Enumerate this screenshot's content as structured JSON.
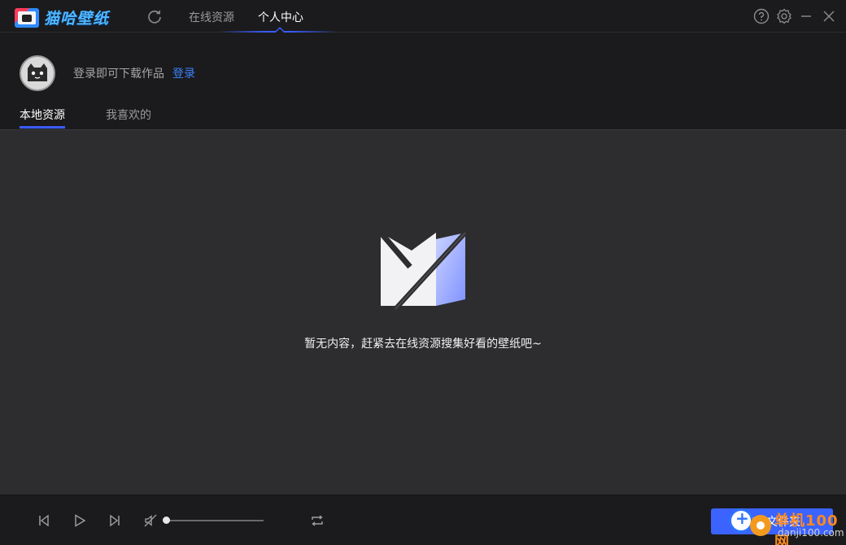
{
  "app": {
    "title": "猫哈壁纸"
  },
  "nav": {
    "tabs": [
      {
        "label": "在线资源",
        "active": false
      },
      {
        "label": "个人中心",
        "active": true
      }
    ]
  },
  "window_controls": [
    "help-icon",
    "settings-icon",
    "minimize-icon",
    "close-icon"
  ],
  "profile": {
    "login_hint": "登录即可下载作品",
    "login_link": "登录"
  },
  "sub_tabs": [
    {
      "label": "本地资源",
      "active": true
    },
    {
      "label": "我喜欢的",
      "active": false
    }
  ],
  "empty_state": {
    "message": "暂无内容，赶紧去在线资源搜集好看的壁纸吧~"
  },
  "player": {
    "volume": 0.0,
    "select_folder_label": "选择文件夹"
  },
  "watermark": {
    "text_cn": "单机100网",
    "url": "danji100.com"
  },
  "colors": {
    "accent": "#3b63ff",
    "link": "#3b82ff",
    "content_bg": "#2d2d2f",
    "chrome_bg": "#1b1b1d"
  }
}
